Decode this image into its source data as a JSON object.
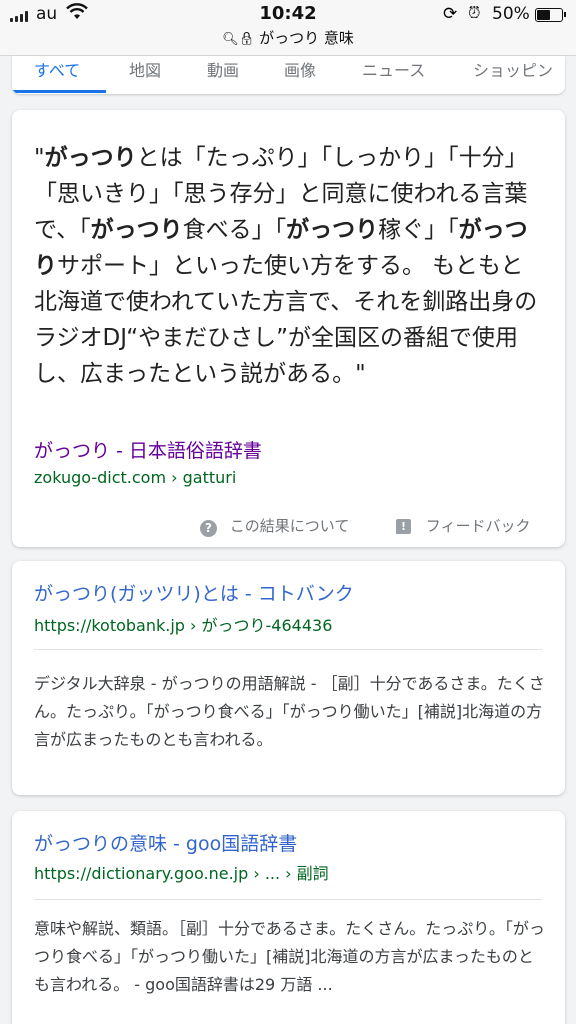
{
  "status_bar": {
    "carrier": "au",
    "time": "10:42",
    "url": "がっつり 意味",
    "battery": "50%",
    "battery_level": 0.5
  },
  "tabs": [
    "すべて",
    "地図",
    "動画",
    "画像",
    "ニュース",
    "ショッピン"
  ],
  "featured": {
    "snippet_parts": [
      {
        "t": "\"",
        "b": false
      },
      {
        "t": "がっつり",
        "b": true
      },
      {
        "t": "とは「たっぷり」「しっかり」「十分」「思いきり」「思う存分」と同意に使われる言葉で、「",
        "b": false
      },
      {
        "t": "がっつり",
        "b": true
      },
      {
        "t": "食べる」「",
        "b": false
      },
      {
        "t": "がっつり",
        "b": true
      },
      {
        "t": "稼ぐ」「",
        "b": false
      },
      {
        "t": "がっつり",
        "b": true
      },
      {
        "t": "サポート」といった使い方をする。 もともと北海道で使われていた方言で、それを釧路出身のラジオDJ“やまだひさし”が全国区の番組で使用し、広まったという説がある。\"",
        "b": false
      }
    ],
    "source_title": "がっつり - 日本語俗語辞書",
    "source_url": "zokugo-dict.com › gatturi",
    "about_label": "この結果について",
    "feedback_label": "フィードバック"
  },
  "results": [
    {
      "title": "がっつり(ガッツリ)とは - コトバンク",
      "url": "https://kotobank.jp › がっつり-464436",
      "description": "デジタル大辞泉 - がっつりの用語解説 - ［副］十分であるさま。たくさん。たっぷり。「がっつり食べる」「がっつり働いた」[補説]北海道の方言が広まったものとも言われる。"
    },
    {
      "title": "がっつりの意味 - goo国語辞書",
      "url": "https://dictionary.goo.ne.jp › ... › 副詞",
      "description": "意味や解説、類語。［副］十分であるさま。たくさん。たっぷり。「がっつり食べる」「がっつり働いた」[補説]北海道の方言が広まったものとも言われる。 - goo国語辞書は29 万語 ..."
    }
  ]
}
